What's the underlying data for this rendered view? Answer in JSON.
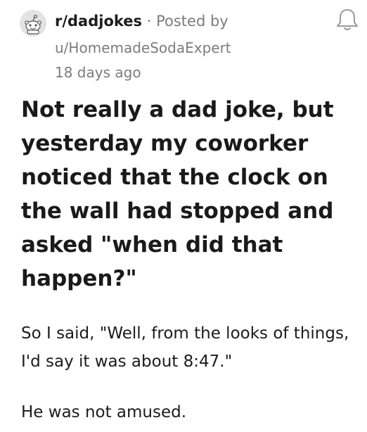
{
  "header": {
    "subreddit": "r/dadjokes",
    "separator": "·",
    "posted_by": "Posted by",
    "username": "u/HomemadeSodaExpert",
    "timestamp": "18 days ago",
    "avatar_icon": "reddit-alien-icon",
    "notification_icon": "bell-icon"
  },
  "post": {
    "title": "Not really a dad joke, but yesterday my coworker noticed that the clock on the wall had stopped and asked \"when did that happen?\"",
    "paragraphs": [
      "So I said, \"Well, from the looks of things, I'd say it was about 8:47.\"",
      "He was not amused."
    ]
  },
  "colors": {
    "text_primary": "#1a1a1b",
    "text_secondary": "#7c7c7c",
    "avatar_bg": "#e3e3e3",
    "background": "#ffffff"
  }
}
